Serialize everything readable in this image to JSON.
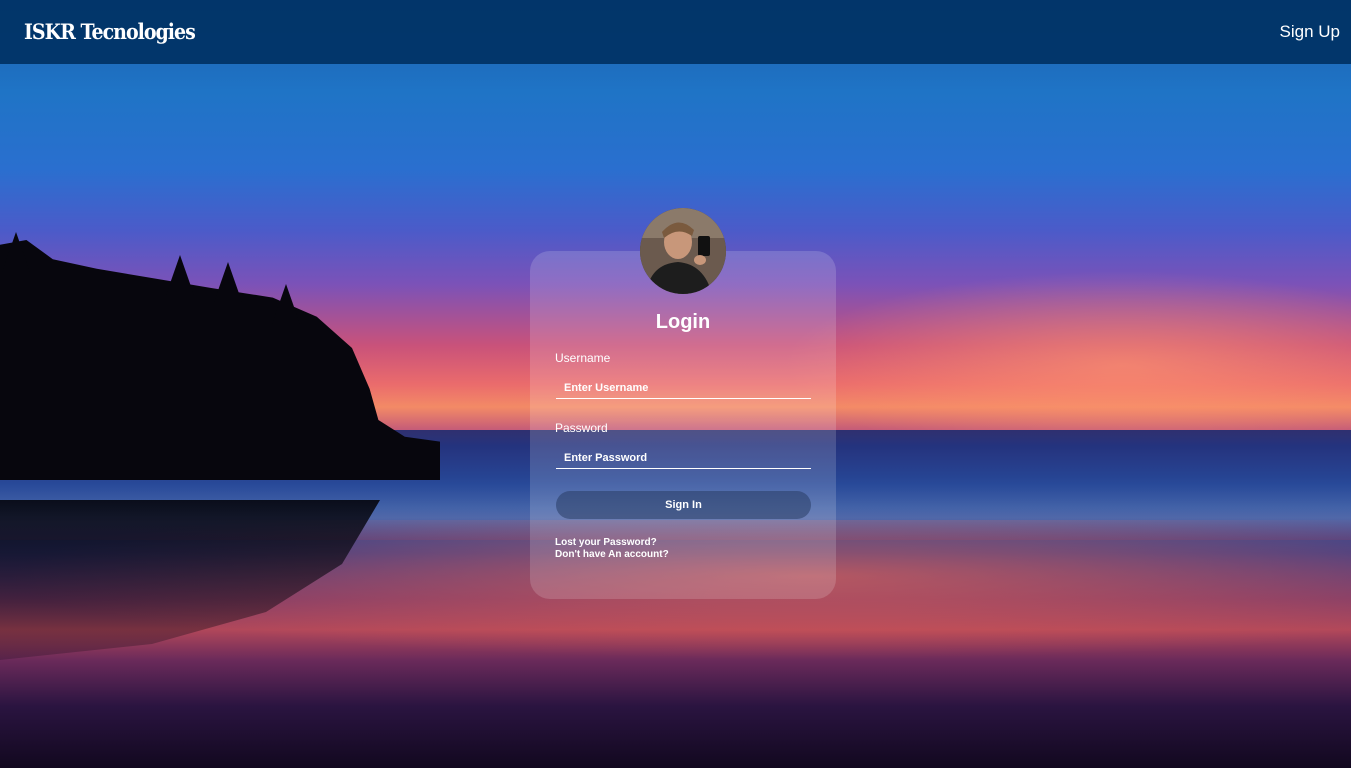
{
  "header": {
    "brand": "ISKR Tecnologies",
    "signup_label": "Sign Up"
  },
  "login": {
    "title": "Login",
    "username_label": "Username",
    "username_placeholder": "Enter Username",
    "password_label": "Password",
    "password_placeholder": "Enter Password",
    "signin_label": "Sign In",
    "lost_password": "Lost your Password?",
    "no_account": "Don't have An account?"
  },
  "colors": {
    "header_bg": "#00325f",
    "text": "#ffffff"
  }
}
